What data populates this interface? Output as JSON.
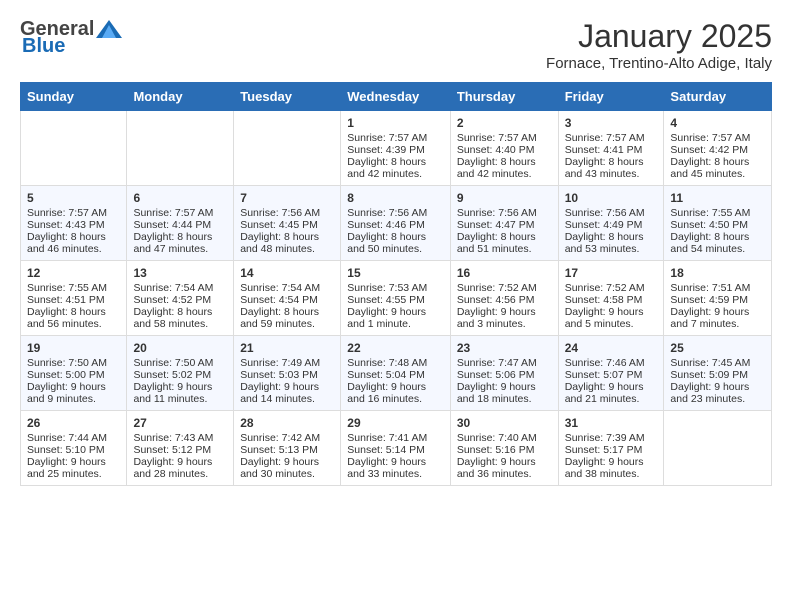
{
  "header": {
    "logo_general": "General",
    "logo_blue": "Blue",
    "month": "January 2025",
    "location": "Fornace, Trentino-Alto Adige, Italy"
  },
  "weekdays": [
    "Sunday",
    "Monday",
    "Tuesday",
    "Wednesday",
    "Thursday",
    "Friday",
    "Saturday"
  ],
  "weeks": [
    [
      {
        "day": "",
        "sunrise": "",
        "sunset": "",
        "daylight": ""
      },
      {
        "day": "",
        "sunrise": "",
        "sunset": "",
        "daylight": ""
      },
      {
        "day": "",
        "sunrise": "",
        "sunset": "",
        "daylight": ""
      },
      {
        "day": "1",
        "sunrise": "Sunrise: 7:57 AM",
        "sunset": "Sunset: 4:39 PM",
        "daylight": "Daylight: 8 hours and 42 minutes."
      },
      {
        "day": "2",
        "sunrise": "Sunrise: 7:57 AM",
        "sunset": "Sunset: 4:40 PM",
        "daylight": "Daylight: 8 hours and 42 minutes."
      },
      {
        "day": "3",
        "sunrise": "Sunrise: 7:57 AM",
        "sunset": "Sunset: 4:41 PM",
        "daylight": "Daylight: 8 hours and 43 minutes."
      },
      {
        "day": "4",
        "sunrise": "Sunrise: 7:57 AM",
        "sunset": "Sunset: 4:42 PM",
        "daylight": "Daylight: 8 hours and 45 minutes."
      }
    ],
    [
      {
        "day": "5",
        "sunrise": "Sunrise: 7:57 AM",
        "sunset": "Sunset: 4:43 PM",
        "daylight": "Daylight: 8 hours and 46 minutes."
      },
      {
        "day": "6",
        "sunrise": "Sunrise: 7:57 AM",
        "sunset": "Sunset: 4:44 PM",
        "daylight": "Daylight: 8 hours and 47 minutes."
      },
      {
        "day": "7",
        "sunrise": "Sunrise: 7:56 AM",
        "sunset": "Sunset: 4:45 PM",
        "daylight": "Daylight: 8 hours and 48 minutes."
      },
      {
        "day": "8",
        "sunrise": "Sunrise: 7:56 AM",
        "sunset": "Sunset: 4:46 PM",
        "daylight": "Daylight: 8 hours and 50 minutes."
      },
      {
        "day": "9",
        "sunrise": "Sunrise: 7:56 AM",
        "sunset": "Sunset: 4:47 PM",
        "daylight": "Daylight: 8 hours and 51 minutes."
      },
      {
        "day": "10",
        "sunrise": "Sunrise: 7:56 AM",
        "sunset": "Sunset: 4:49 PM",
        "daylight": "Daylight: 8 hours and 53 minutes."
      },
      {
        "day": "11",
        "sunrise": "Sunrise: 7:55 AM",
        "sunset": "Sunset: 4:50 PM",
        "daylight": "Daylight: 8 hours and 54 minutes."
      }
    ],
    [
      {
        "day": "12",
        "sunrise": "Sunrise: 7:55 AM",
        "sunset": "Sunset: 4:51 PM",
        "daylight": "Daylight: 8 hours and 56 minutes."
      },
      {
        "day": "13",
        "sunrise": "Sunrise: 7:54 AM",
        "sunset": "Sunset: 4:52 PM",
        "daylight": "Daylight: 8 hours and 58 minutes."
      },
      {
        "day": "14",
        "sunrise": "Sunrise: 7:54 AM",
        "sunset": "Sunset: 4:54 PM",
        "daylight": "Daylight: 8 hours and 59 minutes."
      },
      {
        "day": "15",
        "sunrise": "Sunrise: 7:53 AM",
        "sunset": "Sunset: 4:55 PM",
        "daylight": "Daylight: 9 hours and 1 minute."
      },
      {
        "day": "16",
        "sunrise": "Sunrise: 7:52 AM",
        "sunset": "Sunset: 4:56 PM",
        "daylight": "Daylight: 9 hours and 3 minutes."
      },
      {
        "day": "17",
        "sunrise": "Sunrise: 7:52 AM",
        "sunset": "Sunset: 4:58 PM",
        "daylight": "Daylight: 9 hours and 5 minutes."
      },
      {
        "day": "18",
        "sunrise": "Sunrise: 7:51 AM",
        "sunset": "Sunset: 4:59 PM",
        "daylight": "Daylight: 9 hours and 7 minutes."
      }
    ],
    [
      {
        "day": "19",
        "sunrise": "Sunrise: 7:50 AM",
        "sunset": "Sunset: 5:00 PM",
        "daylight": "Daylight: 9 hours and 9 minutes."
      },
      {
        "day": "20",
        "sunrise": "Sunrise: 7:50 AM",
        "sunset": "Sunset: 5:02 PM",
        "daylight": "Daylight: 9 hours and 11 minutes."
      },
      {
        "day": "21",
        "sunrise": "Sunrise: 7:49 AM",
        "sunset": "Sunset: 5:03 PM",
        "daylight": "Daylight: 9 hours and 14 minutes."
      },
      {
        "day": "22",
        "sunrise": "Sunrise: 7:48 AM",
        "sunset": "Sunset: 5:04 PM",
        "daylight": "Daylight: 9 hours and 16 minutes."
      },
      {
        "day": "23",
        "sunrise": "Sunrise: 7:47 AM",
        "sunset": "Sunset: 5:06 PM",
        "daylight": "Daylight: 9 hours and 18 minutes."
      },
      {
        "day": "24",
        "sunrise": "Sunrise: 7:46 AM",
        "sunset": "Sunset: 5:07 PM",
        "daylight": "Daylight: 9 hours and 21 minutes."
      },
      {
        "day": "25",
        "sunrise": "Sunrise: 7:45 AM",
        "sunset": "Sunset: 5:09 PM",
        "daylight": "Daylight: 9 hours and 23 minutes."
      }
    ],
    [
      {
        "day": "26",
        "sunrise": "Sunrise: 7:44 AM",
        "sunset": "Sunset: 5:10 PM",
        "daylight": "Daylight: 9 hours and 25 minutes."
      },
      {
        "day": "27",
        "sunrise": "Sunrise: 7:43 AM",
        "sunset": "Sunset: 5:12 PM",
        "daylight": "Daylight: 9 hours and 28 minutes."
      },
      {
        "day": "28",
        "sunrise": "Sunrise: 7:42 AM",
        "sunset": "Sunset: 5:13 PM",
        "daylight": "Daylight: 9 hours and 30 minutes."
      },
      {
        "day": "29",
        "sunrise": "Sunrise: 7:41 AM",
        "sunset": "Sunset: 5:14 PM",
        "daylight": "Daylight: 9 hours and 33 minutes."
      },
      {
        "day": "30",
        "sunrise": "Sunrise: 7:40 AM",
        "sunset": "Sunset: 5:16 PM",
        "daylight": "Daylight: 9 hours and 36 minutes."
      },
      {
        "day": "31",
        "sunrise": "Sunrise: 7:39 AM",
        "sunset": "Sunset: 5:17 PM",
        "daylight": "Daylight: 9 hours and 38 minutes."
      },
      {
        "day": "",
        "sunrise": "",
        "sunset": "",
        "daylight": ""
      }
    ]
  ]
}
